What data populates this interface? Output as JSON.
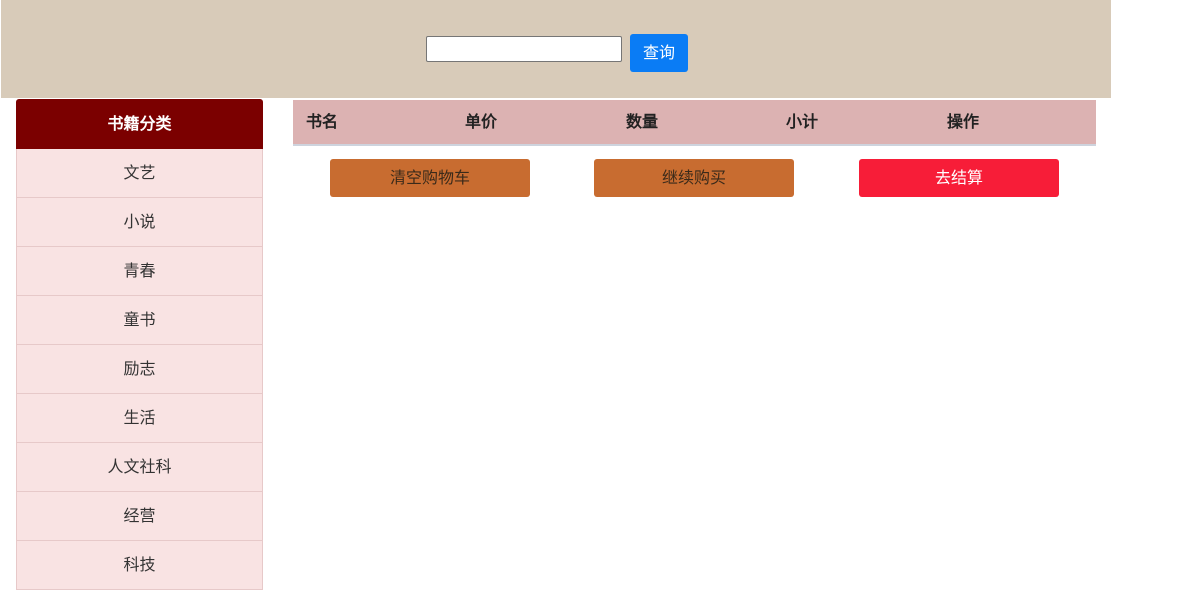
{
  "search": {
    "value": "",
    "placeholder": "",
    "button_label": "查询"
  },
  "sidebar": {
    "title": "书籍分类",
    "items": [
      {
        "label": "文艺"
      },
      {
        "label": "小说"
      },
      {
        "label": "青春"
      },
      {
        "label": "童书"
      },
      {
        "label": "励志"
      },
      {
        "label": "生活"
      },
      {
        "label": "人文社科"
      },
      {
        "label": "经营"
      },
      {
        "label": "科技"
      }
    ]
  },
  "cart": {
    "columns": [
      "书名",
      "单价",
      "数量",
      "小计",
      "操作"
    ],
    "rows": [],
    "actions": {
      "clear_label": "清空购物车",
      "continue_label": "继续购买",
      "checkout_label": "去结算"
    }
  },
  "colors": {
    "topbar": "#d8cbb9",
    "sidebar_header": "#7b0000",
    "sidebar_item": "#f9e3e3",
    "table_header": "#dcb2b2",
    "search_button": "#0a7cf5",
    "secondary_button": "#c86c30",
    "checkout_button": "#f71d38"
  }
}
